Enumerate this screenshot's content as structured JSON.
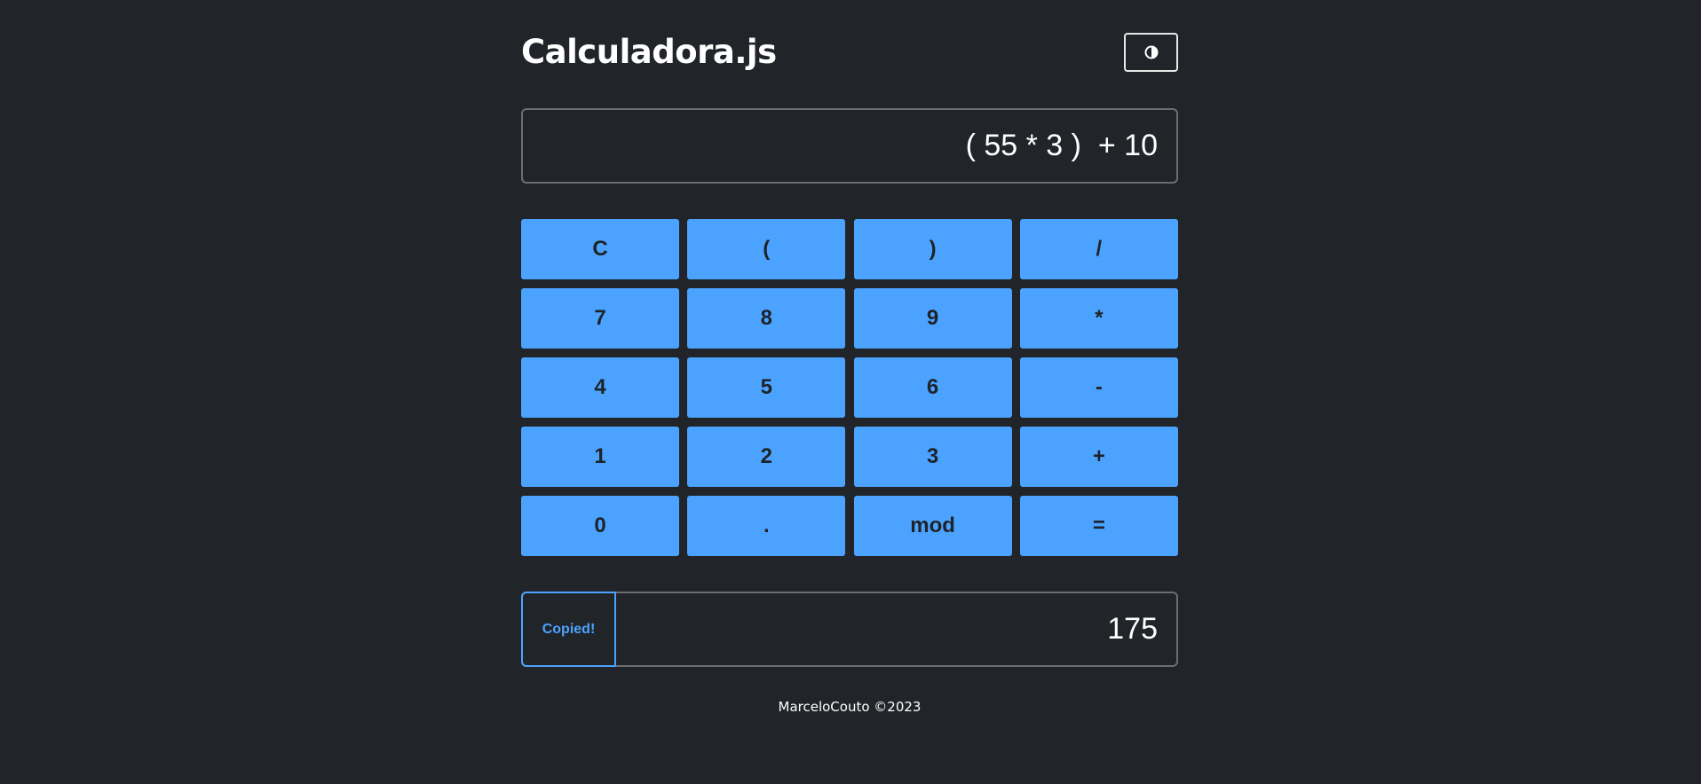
{
  "header": {
    "title": "Calculadora.js",
    "theme_toggle_icon": "contrast-icon"
  },
  "display": {
    "expression": "( 55 * 3 )  + 10"
  },
  "keypad": {
    "keys": [
      "C",
      "(",
      ")",
      "/",
      "7",
      "8",
      "9",
      "*",
      "4",
      "5",
      "6",
      "-",
      "1",
      "2",
      "3",
      "+",
      "0",
      ".",
      "mod",
      "="
    ]
  },
  "result": {
    "copy_label": "Copied!",
    "value": "175"
  },
  "footer": {
    "text": "MarceloCouto ©2023"
  },
  "colors": {
    "background": "#212429",
    "accent": "#4ca3ff",
    "key_text": "#1e2329",
    "border": "#6b6e73"
  }
}
